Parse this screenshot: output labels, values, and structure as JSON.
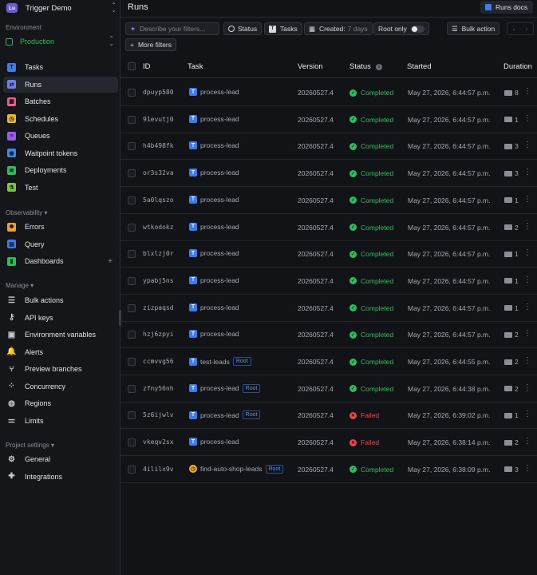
{
  "org": {
    "initials": "Lu",
    "name": "Trigger Demo"
  },
  "sidebar": {
    "environment_label": "Environment",
    "environment": "Production",
    "items": [
      {
        "label": "Tasks",
        "icon": "tasks-icon",
        "color": "#3d7bf2",
        "glyph": "T"
      },
      {
        "label": "Runs",
        "icon": "runs-icon",
        "color": "#6d7cf0",
        "glyph": "⇄"
      },
      {
        "label": "Batches",
        "icon": "batches-icon",
        "color": "#f25c8a",
        "glyph": "▦"
      },
      {
        "label": "Schedules",
        "icon": "schedules-icon",
        "color": "#f0b429",
        "glyph": "◷"
      },
      {
        "label": "Queues",
        "icon": "queues-icon",
        "color": "#9b59f0",
        "glyph": "≡"
      },
      {
        "label": "Waitpoint tokens",
        "icon": "waitpoint-icon",
        "color": "#2f8ef5",
        "glyph": "◉"
      },
      {
        "label": "Deployments",
        "icon": "deployments-icon",
        "color": "#28bf5c",
        "glyph": "≣"
      },
      {
        "label": "Test",
        "icon": "test-flask-icon",
        "color": "#7ac943",
        "glyph": "⚗"
      }
    ],
    "observability_label": "Observability ▾",
    "observability_items": [
      {
        "label": "Errors",
        "icon": "errors-icon",
        "color": "#f0a030",
        "glyph": "✹"
      },
      {
        "label": "Query",
        "icon": "query-icon",
        "color": "#3d7bf2",
        "glyph": "▤"
      },
      {
        "label": "Dashboards",
        "icon": "dashboards-icon",
        "color": "#28bf5c",
        "glyph": "▮"
      }
    ],
    "manage_label": "Manage ▾",
    "manage_items": [
      {
        "label": "Bulk actions",
        "icon": "bulk-actions-icon",
        "glyph": "☰"
      },
      {
        "label": "API keys",
        "icon": "key-icon",
        "glyph": "⚷"
      },
      {
        "label": "Environment variables",
        "icon": "env-vars-icon",
        "glyph": "▣"
      },
      {
        "label": "Alerts",
        "icon": "bell-icon",
        "glyph": "🔔"
      },
      {
        "label": "Preview branches",
        "icon": "branch-icon",
        "glyph": "⑂"
      },
      {
        "label": "Concurrency",
        "icon": "concurrency-icon",
        "glyph": "⁘"
      },
      {
        "label": "Regions",
        "icon": "globe-icon",
        "glyph": "◍"
      },
      {
        "label": "Limits",
        "icon": "limits-icon",
        "glyph": "⚌"
      }
    ],
    "project_label": "Project settings ▾",
    "project_items": [
      {
        "label": "General",
        "icon": "gear-icon",
        "glyph": "⚙"
      },
      {
        "label": "Integrations",
        "icon": "puzzle-icon",
        "glyph": "✚"
      }
    ]
  },
  "header": {
    "title": "Runs",
    "docs_label": "Runs docs"
  },
  "filters": {
    "search_placeholder": "Describe your filters...",
    "status": "Status",
    "tasks": "Tasks",
    "created": "Created:",
    "created_value": "7 days",
    "root_only": "Root only",
    "more_filters": "More filters",
    "bulk_action": "Bulk action"
  },
  "table": {
    "columns": [
      "ID",
      "Task",
      "Version",
      "Status",
      "Started",
      "Duration"
    ],
    "rows": [
      {
        "id": "dpuyp580",
        "task": "process-lead",
        "root": false,
        "version": "20260527.4",
        "status": "Completed",
        "ok": true,
        "started": "May 27, 2026, 6:44:57 p.m.",
        "duration": "8"
      },
      {
        "id": "91evutj0",
        "task": "process-lead",
        "root": false,
        "version": "20260527.4",
        "status": "Completed",
        "ok": true,
        "started": "May 27, 2026, 6:44:57 p.m.",
        "duration": "1"
      },
      {
        "id": "h4b498fk",
        "task": "process-lead",
        "root": false,
        "version": "20260527.4",
        "status": "Completed",
        "ok": true,
        "started": "May 27, 2026, 6:44:57 p.m.",
        "duration": "3"
      },
      {
        "id": "or3s32va",
        "task": "process-lead",
        "root": false,
        "version": "20260527.4",
        "status": "Completed",
        "ok": true,
        "started": "May 27, 2026, 6:44:57 p.m.",
        "duration": "3"
      },
      {
        "id": "5a0lqszo",
        "task": "process-lead",
        "root": false,
        "version": "20260527.4",
        "status": "Completed",
        "ok": true,
        "started": "May 27, 2026, 6:44:57 p.m.",
        "duration": "1"
      },
      {
        "id": "wtkodokz",
        "task": "process-lead",
        "root": false,
        "version": "20260527.4",
        "status": "Completed",
        "ok": true,
        "started": "May 27, 2026, 6:44:57 p.m.",
        "duration": "2"
      },
      {
        "id": "blxlzj0r",
        "task": "process-lead",
        "root": false,
        "version": "20260527.4",
        "status": "Completed",
        "ok": true,
        "started": "May 27, 2026, 6:44:57 p.m.",
        "duration": "1"
      },
      {
        "id": "ypabj5ns",
        "task": "process-lead",
        "root": false,
        "version": "20260527.4",
        "status": "Completed",
        "ok": true,
        "started": "May 27, 2026, 6:44:57 p.m.",
        "duration": "1"
      },
      {
        "id": "zizpaqsd",
        "task": "process-lead",
        "root": false,
        "version": "20260527.4",
        "status": "Completed",
        "ok": true,
        "started": "May 27, 2026, 6:44:57 p.m.",
        "duration": "1"
      },
      {
        "id": "hzj6zpyi",
        "task": "process-lead",
        "root": false,
        "version": "20260527.4",
        "status": "Completed",
        "ok": true,
        "started": "May 27, 2026, 6:44:57 p.m.",
        "duration": "2"
      },
      {
        "id": "ccmvvg56",
        "task": "test-leads",
        "root": true,
        "version": "20260527.4",
        "status": "Completed",
        "ok": true,
        "started": "May 27, 2026, 6:44:55 p.m.",
        "duration": "2"
      },
      {
        "id": "zfny56nh",
        "task": "process-lead",
        "root": true,
        "version": "20260527.4",
        "status": "Completed",
        "ok": true,
        "started": "May 27, 2026, 6:44:38 p.m.",
        "duration": "2"
      },
      {
        "id": "5z6ijwlv",
        "task": "process-lead",
        "root": true,
        "version": "20260527.4",
        "status": "Failed",
        "ok": false,
        "started": "May 27, 2026, 6:39:02 p.m.",
        "duration": "1"
      },
      {
        "id": "vkeqv2sx",
        "task": "process-lead",
        "root": false,
        "version": "20260527.4",
        "status": "Failed",
        "ok": false,
        "started": "May 27, 2026, 6:38:14 p.m.",
        "duration": "2"
      },
      {
        "id": "4ililx9v",
        "task": "find-auto-shop-leads",
        "root": true,
        "schedule": true,
        "version": "20260527.4",
        "status": "Completed",
        "ok": true,
        "started": "May 27, 2026, 6:38:09 p.m.",
        "duration": "3"
      }
    ],
    "root_badge": "Root"
  }
}
